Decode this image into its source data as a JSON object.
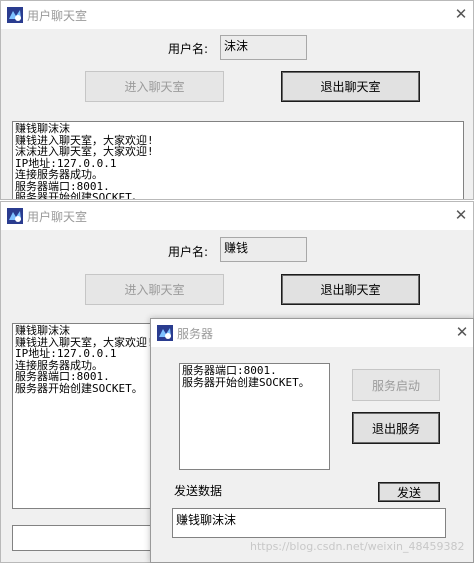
{
  "window1": {
    "title": "用户聊天室",
    "close": "✕",
    "username_label": "用户名:",
    "username_value": "沫沫",
    "enter_button": "进入聊天室",
    "exit_button": "退出聊天室",
    "log": [
      "赚钱聊沫沫",
      "赚钱进入聊天室，大家欢迎!",
      "沫沫进入聊天室，大家欢迎!",
      "IP地址:127.0.0.1",
      "连接服务器成功。",
      "服务器端口:8001.",
      "服务器开始创建SOCKET。"
    ]
  },
  "window2": {
    "title": "用户聊天室",
    "close": "✕",
    "username_label": "用户名:",
    "username_value": "赚钱",
    "enter_button": "进入聊天室",
    "exit_button": "退出聊天室",
    "log": [
      "赚钱聊沫沫",
      "赚钱进入聊天室，大家欢迎!",
      "IP地址:127.0.0.1",
      "连接服务器成功。",
      "服务器端口:8001.",
      "服务器开始创建SOCKET。"
    ]
  },
  "server": {
    "title": "服务器",
    "close": "✕",
    "log": [
      "服务器端口:8001.",
      "服务器开始创建SOCKET。"
    ],
    "start_button": "服务启动",
    "exit_button": "退出服务",
    "send_label": "发送数据",
    "send_button": "发送",
    "message_value": "赚钱聊沫沫"
  },
  "watermark": "https://blog.csdn.net/weixin_48459382"
}
